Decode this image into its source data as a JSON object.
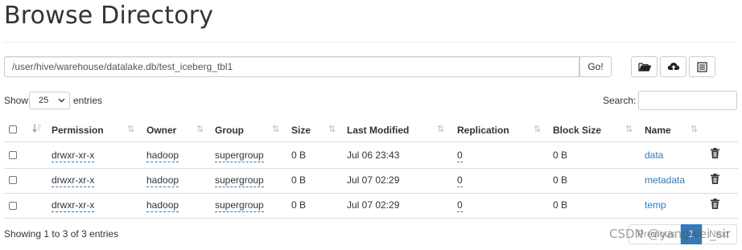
{
  "page": {
    "title": "Browse Directory"
  },
  "toolbar": {
    "path": "/user/hive/warehouse/datalake.db/test_iceberg_tbl1",
    "go_label": "Go!",
    "icons": [
      "folder-open-icon",
      "cloud-upload-icon",
      "list-icon"
    ]
  },
  "controls": {
    "show_label": "Show",
    "page_length": "25",
    "entries_label": "entries",
    "search_label": "Search:",
    "search_value": ""
  },
  "table": {
    "columns": [
      "Permission",
      "Owner",
      "Group",
      "Size",
      "Last Modified",
      "Replication",
      "Block Size",
      "Name"
    ],
    "rows": [
      {
        "permission": "drwxr-xr-x",
        "owner": "hadoop",
        "group": "supergroup",
        "size": "0 B",
        "last_modified": "Jul 06 23:43",
        "replication": "0",
        "block_size": "0 B",
        "name": "data"
      },
      {
        "permission": "drwxr-xr-x",
        "owner": "hadoop",
        "group": "supergroup",
        "size": "0 B",
        "last_modified": "Jul 07 02:29",
        "replication": "0",
        "block_size": "0 B",
        "name": "metadata"
      },
      {
        "permission": "drwxr-xr-x",
        "owner": "hadoop",
        "group": "supergroup",
        "size": "0 B",
        "last_modified": "Jul 07 02:29",
        "replication": "0",
        "block_size": "0 B",
        "name": "temp"
      }
    ]
  },
  "footer": {
    "info": "Showing 1 to 3 of 3 entries",
    "previous": "Previous",
    "current_page": "1",
    "next": "Next"
  },
  "watermark": "CSDN @yangwei_sir",
  "colors": {
    "link": "#337ab7",
    "active_page": "#337ab7"
  }
}
